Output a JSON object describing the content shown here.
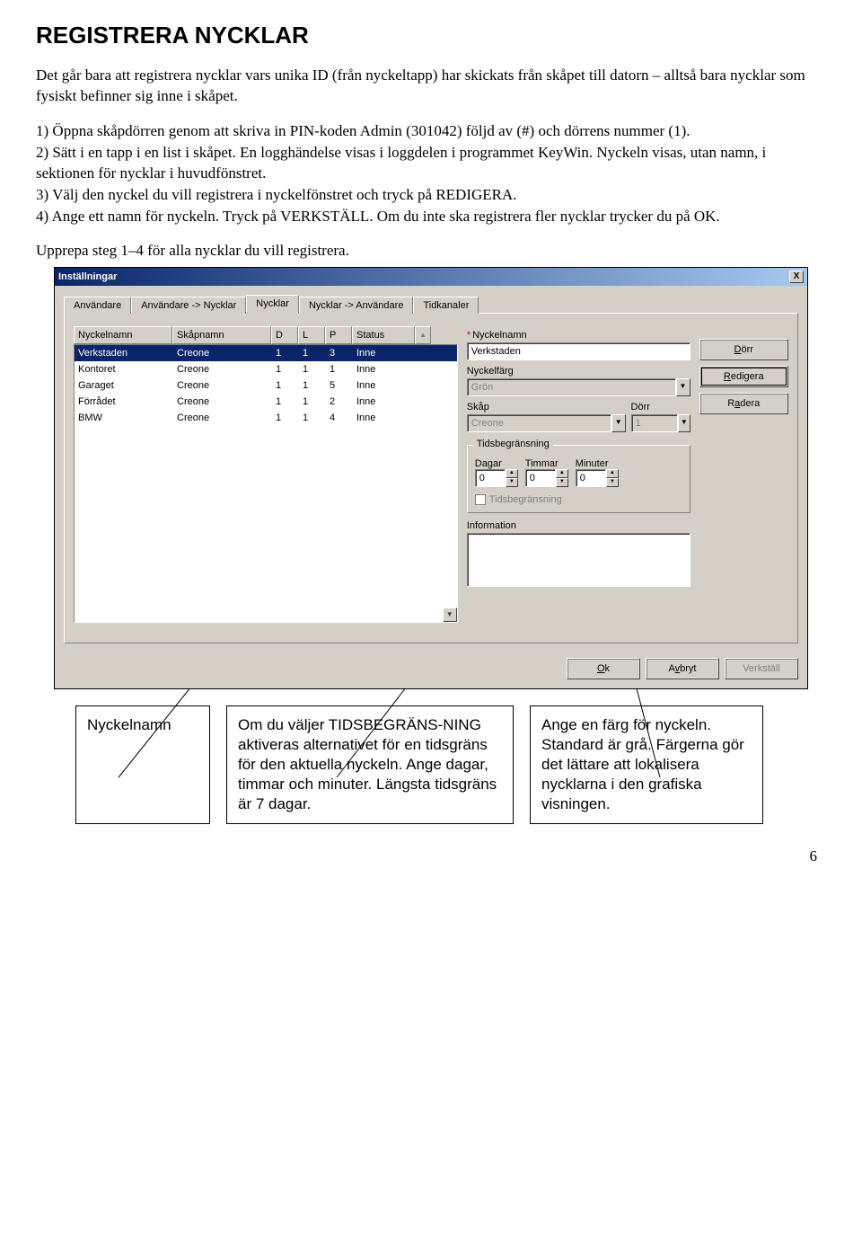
{
  "heading": "REGISTRERA NYCKLAR",
  "intro": "Det går bara att registrera nycklar vars unika ID (från nyckeltapp) har skickats från skåpet till datorn – alltså bara nycklar som fysiskt befinner sig inne i skåpet.",
  "steps": [
    "1)  Öppna skåpdörren genom att skriva in PIN-koden Admin (301042) följd av (#) och dörrens nummer (1).",
    "2)  Sätt i en tapp i en list i skåpet. En logghändelse visas i loggdelen i programmet KeyWin. Nyckeln visas, utan namn, i sektionen för nycklar i huvudfönstret.",
    "3)  Välj den nyckel du vill registrera i nyckelfönstret och tryck på REDIGERA.",
    "4)  Ange ett namn för nyckeln. Tryck på VERKSTÄLL. Om du inte ska registrera fler nycklar trycker du på OK."
  ],
  "repeat": "Upprepa steg 1–4 för alla nycklar du vill registrera.",
  "dialog": {
    "title": "Inställningar",
    "close": "X",
    "tabs": [
      "Användare",
      "Användare -> Nycklar",
      "Nycklar",
      "Nycklar -> Användare",
      "Tidkanaler"
    ],
    "active_tab_index": 2,
    "columns": [
      "Nyckelnamn",
      "Skåpnamn",
      "D",
      "L",
      "P",
      "Status"
    ],
    "rows": [
      {
        "name": "Verkstaden",
        "cab": "Creone",
        "d": "1",
        "l": "1",
        "p": "3",
        "status": "Inne",
        "selected": true
      },
      {
        "name": "Kontoret",
        "cab": "Creone",
        "d": "1",
        "l": "1",
        "p": "1",
        "status": "Inne",
        "selected": false
      },
      {
        "name": "Garaget",
        "cab": "Creone",
        "d": "1",
        "l": "1",
        "p": "5",
        "status": "Inne",
        "selected": false
      },
      {
        "name": "Förrådet",
        "cab": "Creone",
        "d": "1",
        "l": "1",
        "p": "2",
        "status": "Inne",
        "selected": false
      },
      {
        "name": "BMW",
        "cab": "Creone",
        "d": "1",
        "l": "1",
        "p": "4",
        "status": "Inne",
        "selected": false
      }
    ],
    "form": {
      "name_label": "Nyckelnamn",
      "name_value": "Verkstaden",
      "color_label": "Nyckelfärg",
      "color_value": "Grön",
      "cabinet_label": "Skåp",
      "cabinet_value": "Creone",
      "door_label": "Dörr",
      "door_value": "1",
      "time_legend": "Tidsbegränsning",
      "days_label": "Dagar",
      "hours_label": "Timmar",
      "minutes_label": "Minuter",
      "days_value": "0",
      "hours_value": "0",
      "minutes_value": "0",
      "time_check": "Tidsbegränsning",
      "info_label": "Information"
    },
    "buttons": {
      "door": "Dörr",
      "edit": "Redigera",
      "delete": "Radera",
      "ok": "Ok",
      "cancel": "Avbryt",
      "apply": "Verkställ"
    }
  },
  "callouts": {
    "c1": "Nyckelnamn",
    "c2": "Om du väljer TIDSBEGRÄNS-NING aktiveras alternativet för en tidsgräns för den aktuella nyckeln. Ange dagar, timmar och minuter. Längsta tidsgräns är 7 dagar.",
    "c3": "Ange en färg för nyckeln. Standard är grå. Färgerna gör det lättare att lokalisera nycklarna i den grafiska visningen."
  },
  "page_number": "6"
}
